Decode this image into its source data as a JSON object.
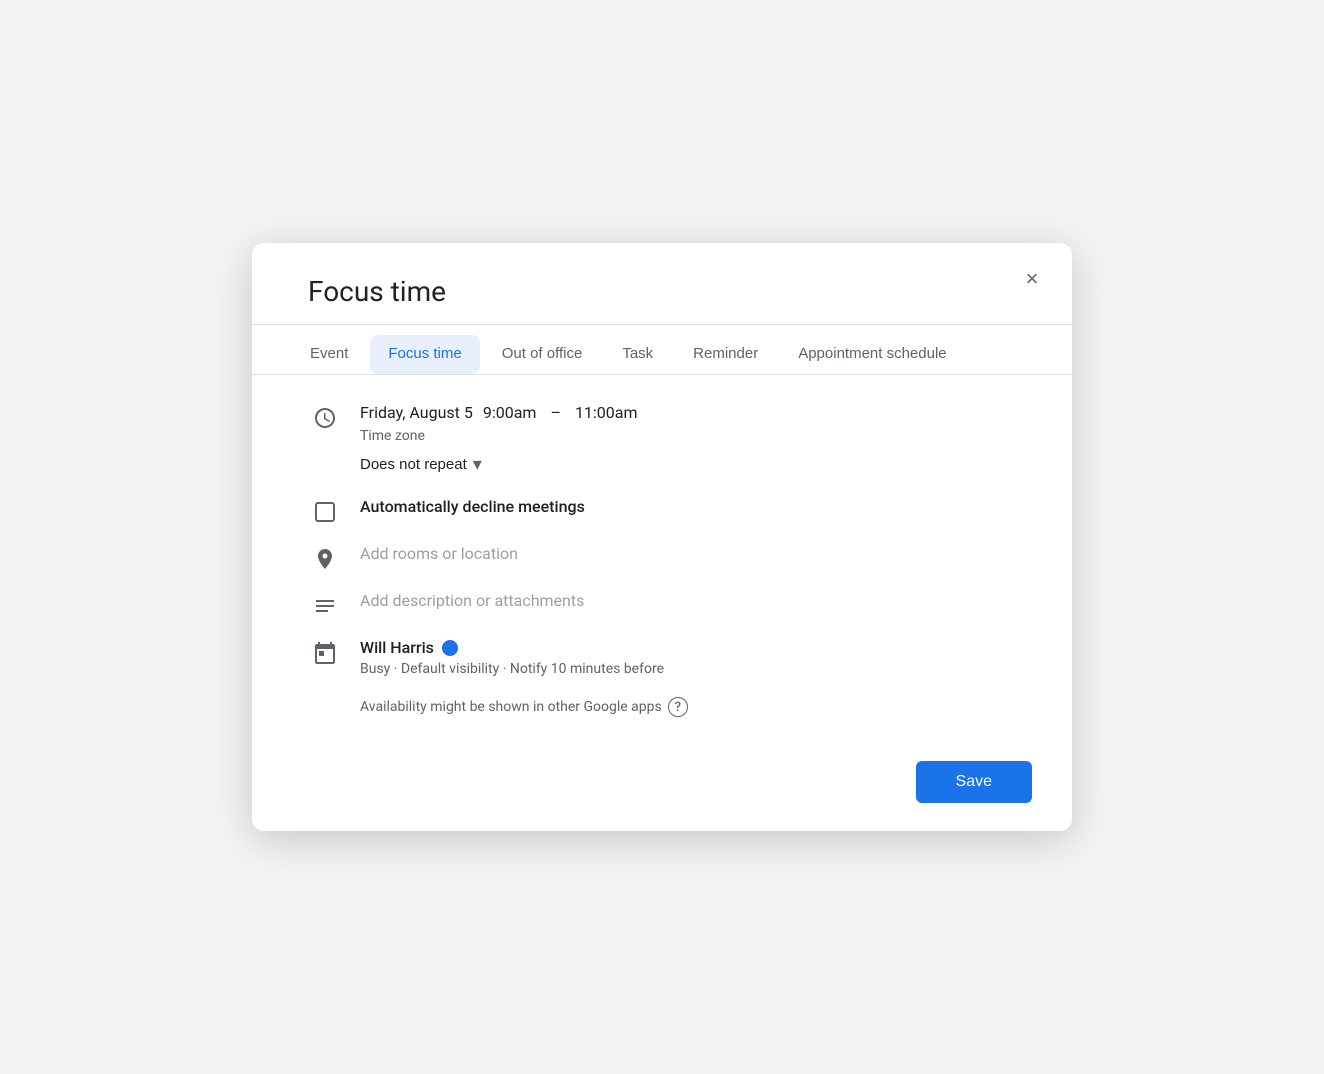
{
  "dialog": {
    "title": "Focus time",
    "close_label": "×"
  },
  "tabs": [
    {
      "id": "event",
      "label": "Event",
      "active": false
    },
    {
      "id": "focus-time",
      "label": "Focus time",
      "active": true
    },
    {
      "id": "out-of-office",
      "label": "Out of office",
      "active": false
    },
    {
      "id": "task",
      "label": "Task",
      "active": false
    },
    {
      "id": "reminder",
      "label": "Reminder",
      "active": false
    },
    {
      "id": "appointment-schedule",
      "label": "Appointment schedule",
      "active": false
    }
  ],
  "event_details": {
    "date": "Friday, August 5",
    "start_time": "9:00am",
    "dash": "–",
    "end_time": "11:00am",
    "timezone_label": "Time zone",
    "repeat_label": "Does not repeat"
  },
  "sections": {
    "decline_meetings": "Automatically decline meetings",
    "location_placeholder": "Add rooms or location",
    "description_placeholder": "Add description or attachments",
    "user_name": "Will Harris",
    "user_status": "Busy · Default visibility · Notify 10 minutes before",
    "availability_note": "Availability might be shown in other Google apps"
  },
  "footer": {
    "save_label": "Save"
  },
  "icons": {
    "clock": "clock-icon",
    "checkbox": "checkbox-icon",
    "location": "location-icon",
    "description": "description-icon",
    "calendar": "calendar-icon"
  }
}
